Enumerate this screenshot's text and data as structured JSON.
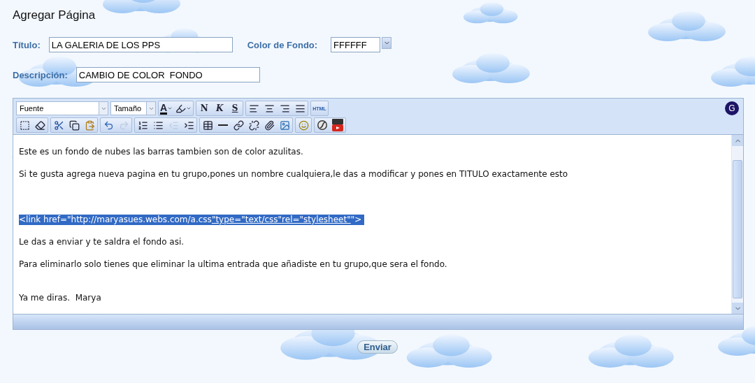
{
  "page_title": "Agregar Página",
  "fields": {
    "title": {
      "label": "Título:",
      "value": "LA GALERIA DE LOS PPS"
    },
    "color": {
      "label": "Color de Fondo:",
      "value": "FFFFFF"
    },
    "description": {
      "label": "Descripción:",
      "value": "CAMBIO DE COLOR  FONDO"
    }
  },
  "editor": {
    "font_select": "Fuente",
    "size_select": "Tamaño",
    "badge": "G",
    "toolbar_rows": [
      [
        [
          {
            "kind": "font-color",
            "label": "A",
            "disabled": false
          },
          {
            "kind": "highlight",
            "disabled": false
          }
        ],
        [
          {
            "kind": "bold",
            "label": "N",
            "disabled": false
          },
          {
            "kind": "italic",
            "label": "K",
            "disabled": false
          },
          {
            "kind": "strike",
            "label": "S",
            "disabled": false
          }
        ],
        [
          {
            "kind": "align-left",
            "disabled": false
          },
          {
            "kind": "align-center",
            "disabled": false
          },
          {
            "kind": "align-right",
            "disabled": false
          },
          {
            "kind": "align-justify",
            "disabled": false
          }
        ],
        [
          {
            "kind": "html",
            "label": "HTML",
            "disabled": false
          }
        ]
      ],
      [
        [
          {
            "kind": "select-all",
            "disabled": false
          },
          {
            "kind": "eraser",
            "disabled": false
          }
        ],
        [
          {
            "kind": "cut",
            "disabled": false
          },
          {
            "kind": "copy",
            "disabled": false
          },
          {
            "kind": "paste",
            "disabled": false
          }
        ],
        [
          {
            "kind": "undo",
            "disabled": false
          },
          {
            "kind": "redo",
            "disabled": true
          }
        ],
        [
          {
            "kind": "ordered-list",
            "disabled": false
          },
          {
            "kind": "bullet-list",
            "disabled": false
          },
          {
            "kind": "outdent",
            "disabled": true
          },
          {
            "kind": "indent",
            "disabled": false
          }
        ],
        [
          {
            "kind": "table",
            "disabled": false
          },
          {
            "kind": "rule",
            "disabled": false
          },
          {
            "kind": "link",
            "disabled": false
          },
          {
            "kind": "unlink",
            "disabled": false
          },
          {
            "kind": "attach",
            "disabled": false
          },
          {
            "kind": "image",
            "disabled": false
          }
        ],
        [
          {
            "kind": "smiley",
            "disabled": false
          }
        ],
        [
          {
            "kind": "flash",
            "disabled": false
          },
          {
            "kind": "video",
            "disabled": false
          }
        ]
      ]
    ],
    "sections": [
      [
        {
          "selected": false,
          "segments": [
            {
              "text": "Este es un fondo de nubes las barras tambien son de color azulitas.",
              "underlined": false
            }
          ]
        },
        {
          "selected": false,
          "segments": [
            {
              "text": "Si te gusta agrega nueva pagina en tu grupo,pones un nombre cualquiera,le das a modificar y pones en TITULO exactamente esto",
              "underlined": false
            }
          ]
        }
      ],
      [
        {
          "selected": true,
          "segments": [
            {
              "text": "<link href=\"http://maryasues.webs.com/a.css",
              "underlined": false
            },
            {
              "text": "\"type=\"text/css\"rel=\"stylesheet\"",
              "underlined": true
            },
            {
              "text": "\">",
              "underlined": false
            }
          ]
        },
        {
          "selected": false,
          "segments": [
            {
              "text": "Le das a enviar y te saldra el fondo asi.",
              "underlined": false
            }
          ]
        },
        {
          "selected": false,
          "segments": [
            {
              "text": "Para eliminarlo solo tienes que eliminar la ultima entrada que añadiste en tu grupo,que sera el fondo.",
              "underlined": false
            }
          ]
        }
      ],
      [
        {
          "selected": false,
          "segments": [
            {
              "text": "Ya me diras.  Marya",
              "underlined": false
            }
          ]
        }
      ]
    ]
  },
  "submit": "Enviar"
}
